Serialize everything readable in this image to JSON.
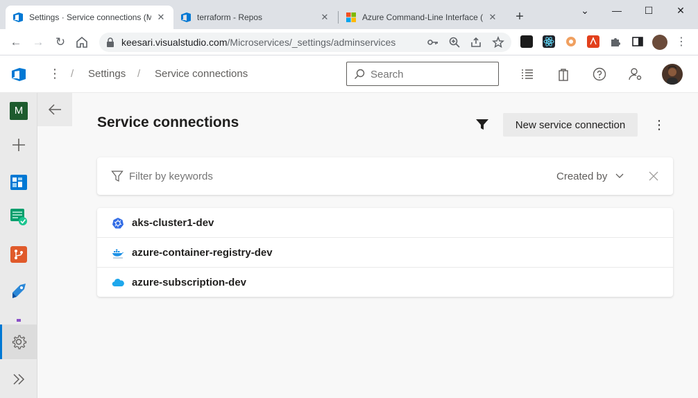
{
  "browser": {
    "tabs": [
      {
        "title": "Settings · Service connections (M",
        "active": true
      },
      {
        "title": "terraform - Repos",
        "active": false
      },
      {
        "title": "Azure Command-Line Interface (",
        "active": false
      }
    ],
    "url_host": "keesari.visualstudio.com",
    "url_path": "/Microservices/_settings/adminservices"
  },
  "header": {
    "breadcrumb": [
      "Settings",
      "Service connections"
    ],
    "search_placeholder": "Search"
  },
  "leftnav": {
    "project_initial": "M"
  },
  "main": {
    "title": "Service connections",
    "new_button": "New service connection",
    "filter_placeholder": "Filter by keywords",
    "created_by_label": "Created by",
    "connections": [
      {
        "name": "aks-cluster1-dev",
        "icon": "kubernetes-icon"
      },
      {
        "name": "azure-container-registry-dev",
        "icon": "docker-icon"
      },
      {
        "name": "azure-subscription-dev",
        "icon": "azure-cloud-icon"
      }
    ]
  },
  "colors": {
    "accent": "#0078d4",
    "project_badge": "#1e5b2e"
  }
}
